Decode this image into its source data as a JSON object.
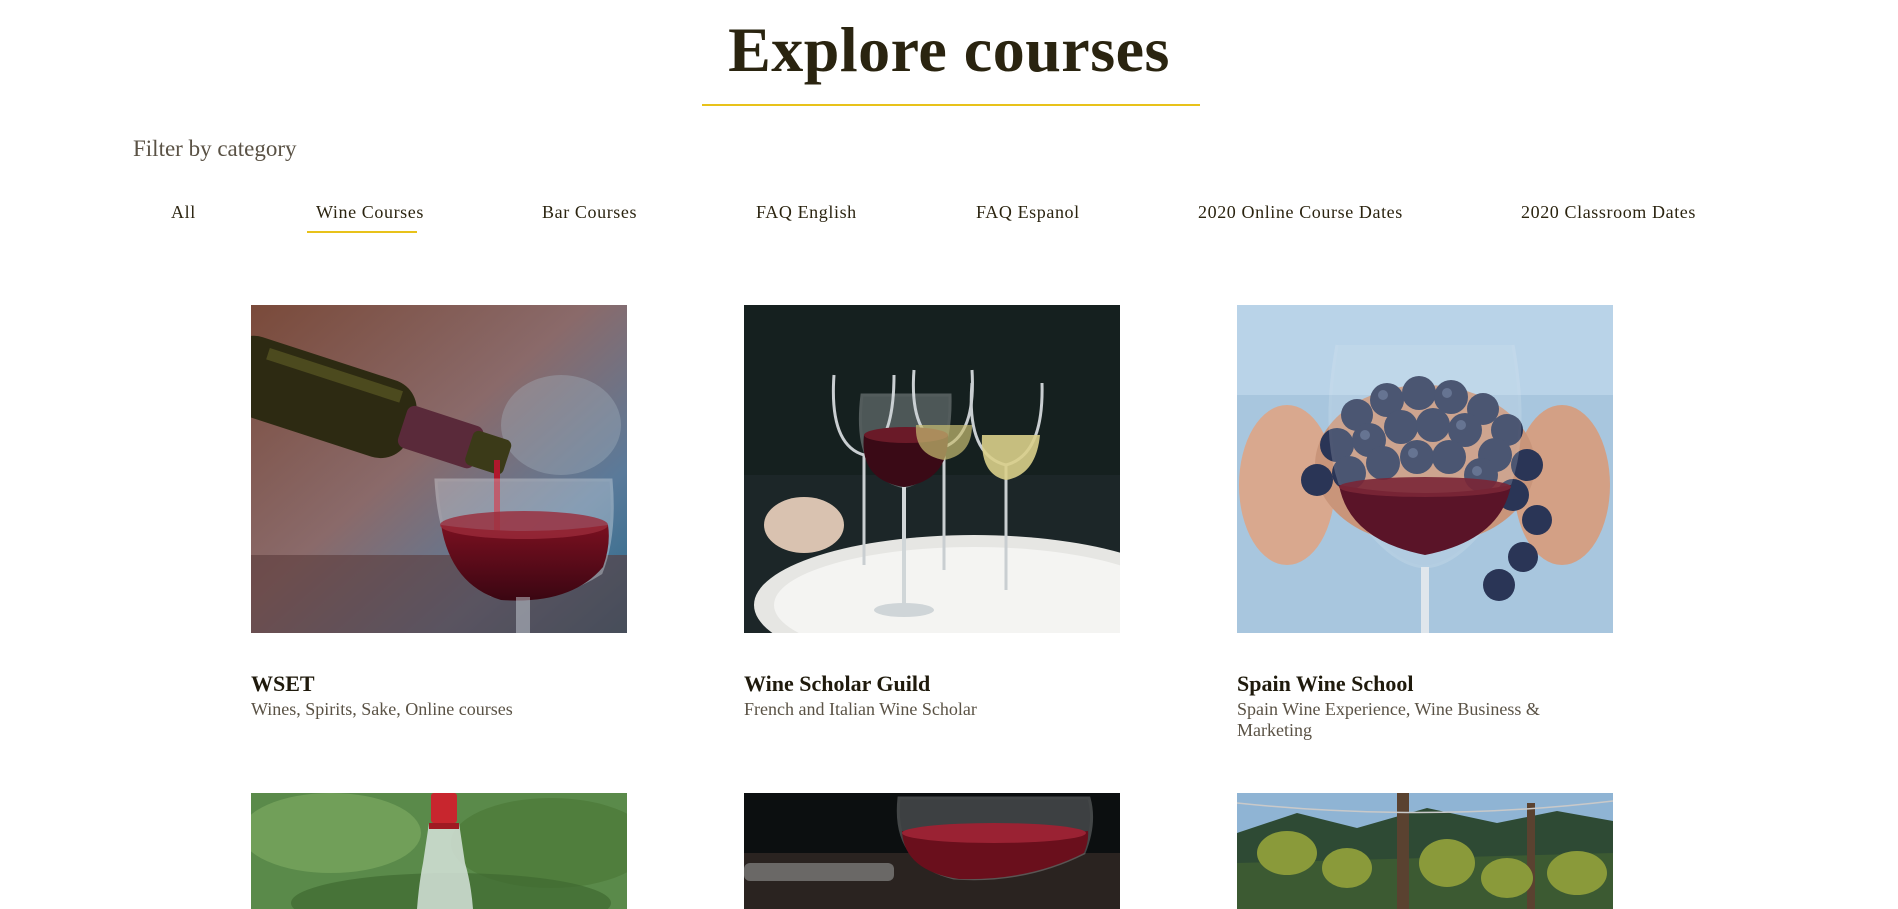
{
  "page": {
    "title": "Explore courses",
    "filter_label": "Filter by category"
  },
  "filters": [
    {
      "label": "All",
      "active": false
    },
    {
      "label": "Wine Courses",
      "active": true
    },
    {
      "label": "Bar Courses",
      "active": false
    },
    {
      "label": "FAQ English",
      "active": false
    },
    {
      "label": "FAQ Espanol",
      "active": false
    },
    {
      "label": "2020 Online Course Dates",
      "active": false
    },
    {
      "label": "2020 Classroom Dates",
      "active": false
    }
  ],
  "courses": [
    {
      "title": "WSET",
      "subtitle": "Wines, Spirits, Sake, Online courses",
      "image": "wine-pouring-photo"
    },
    {
      "title": "Wine Scholar Guild",
      "subtitle": "French and Italian Wine Scholar",
      "image": "wine-glasses-tray-photo"
    },
    {
      "title": "Spain Wine School",
      "subtitle": "Spain Wine Experience, Wine Business & Marketing",
      "image": "grapes-in-glass-photo"
    }
  ],
  "more_courses": [
    {
      "image": "wine-bottle-field-photo"
    },
    {
      "image": "wine-glass-table-photo"
    },
    {
      "image": "vineyard-photo"
    }
  ],
  "colors": {
    "accent": "#e8c21a",
    "heading": "#2a2410",
    "muted_text": "#5a5245"
  }
}
